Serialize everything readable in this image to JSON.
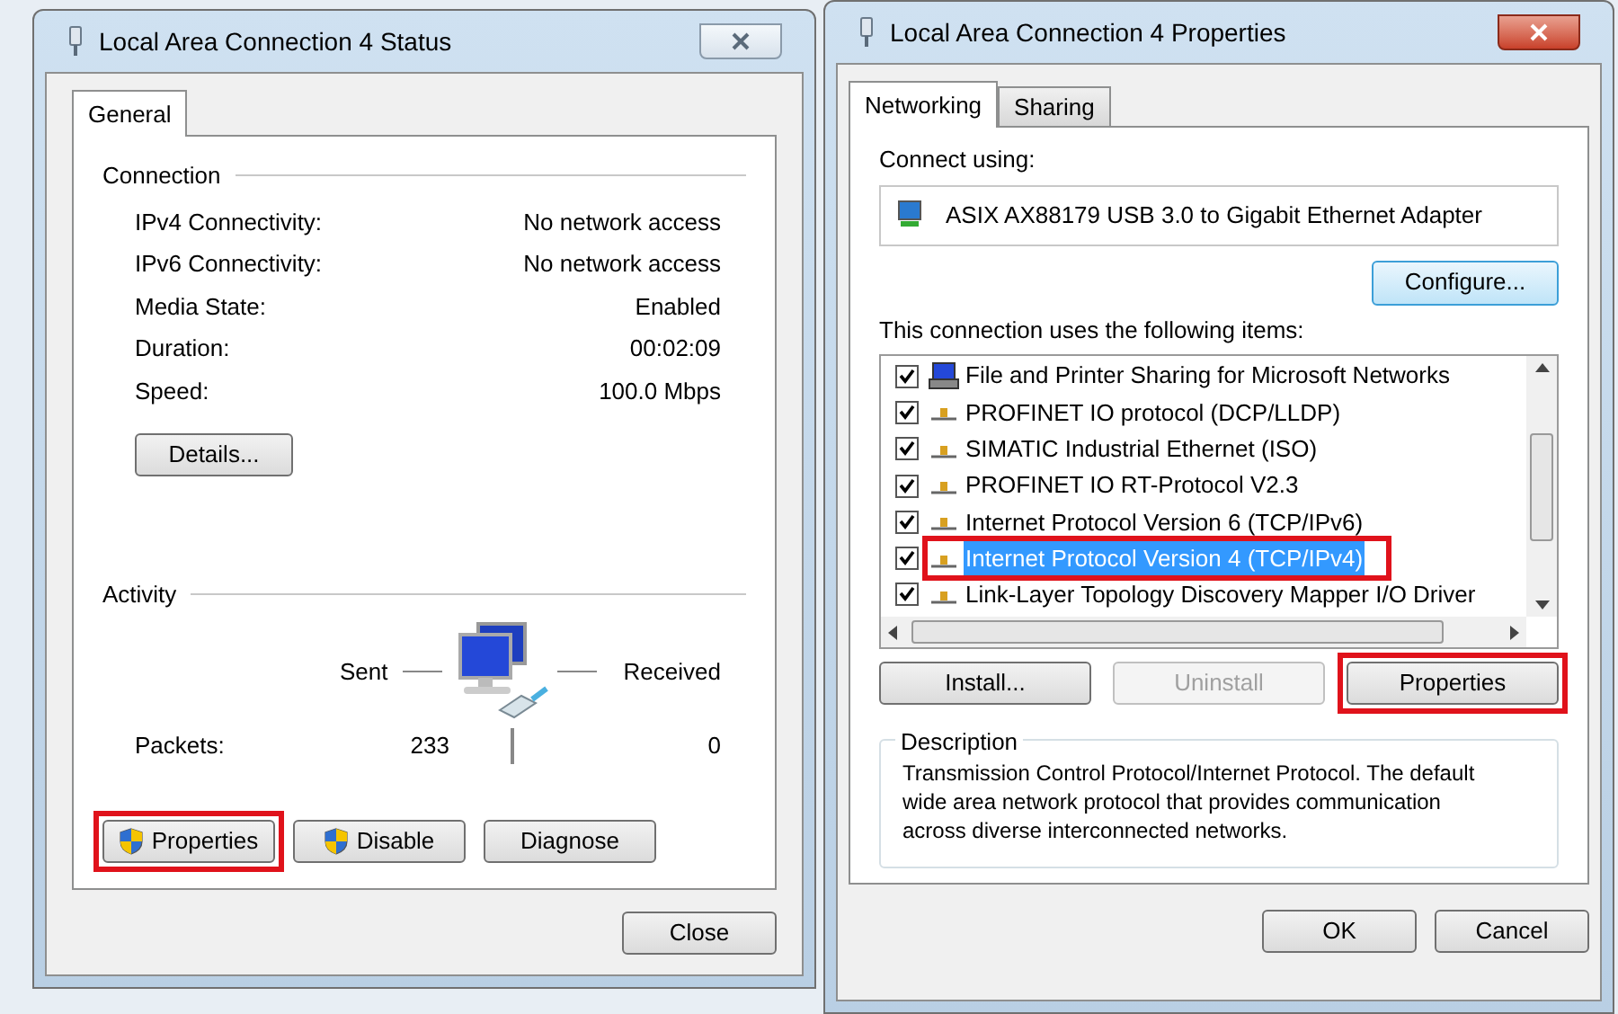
{
  "status_window": {
    "title": "Local Area Connection 4 Status",
    "tabs": [
      {
        "label": "General",
        "selected": true
      }
    ],
    "connection": {
      "heading": "Connection",
      "rows": [
        {
          "label": "IPv4 Connectivity:",
          "value": "No network access"
        },
        {
          "label": "IPv6 Connectivity:",
          "value": "No network access"
        },
        {
          "label": "Media State:",
          "value": "Enabled"
        },
        {
          "label": "Duration:",
          "value": "00:02:09"
        },
        {
          "label": "Speed:",
          "value": "100.0 Mbps"
        }
      ]
    },
    "details_button": "Details...",
    "activity": {
      "heading": "Activity",
      "sent_label": "Sent",
      "received_label": "Received",
      "packets_label": "Packets:",
      "sent": "233",
      "received": "0"
    },
    "buttons": [
      {
        "label": "Properties",
        "shield": true,
        "highlighted": true
      },
      {
        "label": "Disable",
        "shield": true,
        "highlighted": false
      },
      {
        "label": "Diagnose",
        "shield": false,
        "highlighted": false
      }
    ],
    "close_button": "Close"
  },
  "properties_window": {
    "title": "Local Area Connection 4 Properties",
    "tabs": [
      {
        "label": "Networking",
        "selected": true
      },
      {
        "label": "Sharing",
        "selected": false
      }
    ],
    "connect_using_label": "Connect using:",
    "adapter": "ASIX AX88179 USB 3.0 to Gigabit Ethernet Adapter",
    "configure_button": {
      "label": "Configure...",
      "focused": true
    },
    "items_label": "This connection uses the following items:",
    "items": [
      {
        "label": "File and Printer Sharing for Microsoft Networks",
        "kind": "service",
        "checked": true,
        "selected": false,
        "highlighted": false
      },
      {
        "label": "PROFINET IO protocol (DCP/LLDP)",
        "kind": "protocol",
        "checked": true,
        "selected": false,
        "highlighted": false
      },
      {
        "label": "SIMATIC Industrial Ethernet (ISO)",
        "kind": "protocol",
        "checked": true,
        "selected": false,
        "highlighted": false
      },
      {
        "label": "PROFINET IO RT-Protocol V2.3",
        "kind": "protocol",
        "checked": true,
        "selected": false,
        "highlighted": false
      },
      {
        "label": "Internet Protocol Version 6 (TCP/IPv6)",
        "kind": "protocol",
        "checked": true,
        "selected": false,
        "highlighted": false
      },
      {
        "label": "Internet Protocol Version 4 (TCP/IPv4)",
        "kind": "protocol",
        "checked": true,
        "selected": true,
        "highlighted": true
      },
      {
        "label": "Link-Layer Topology Discovery Mapper I/O Driver",
        "kind": "protocol",
        "checked": true,
        "selected": false,
        "highlighted": false
      }
    ],
    "action_buttons": [
      {
        "label": "Install...",
        "disabled": false,
        "highlighted": false
      },
      {
        "label": "Uninstall",
        "disabled": true,
        "highlighted": false
      },
      {
        "label": "Properties",
        "disabled": false,
        "highlighted": true
      }
    ],
    "description": {
      "heading": "Description",
      "text": "Transmission Control Protocol/Internet Protocol. The default wide area network protocol that provides communication across diverse interconnected networks."
    },
    "footer_buttons": [
      "OK",
      "Cancel"
    ]
  }
}
